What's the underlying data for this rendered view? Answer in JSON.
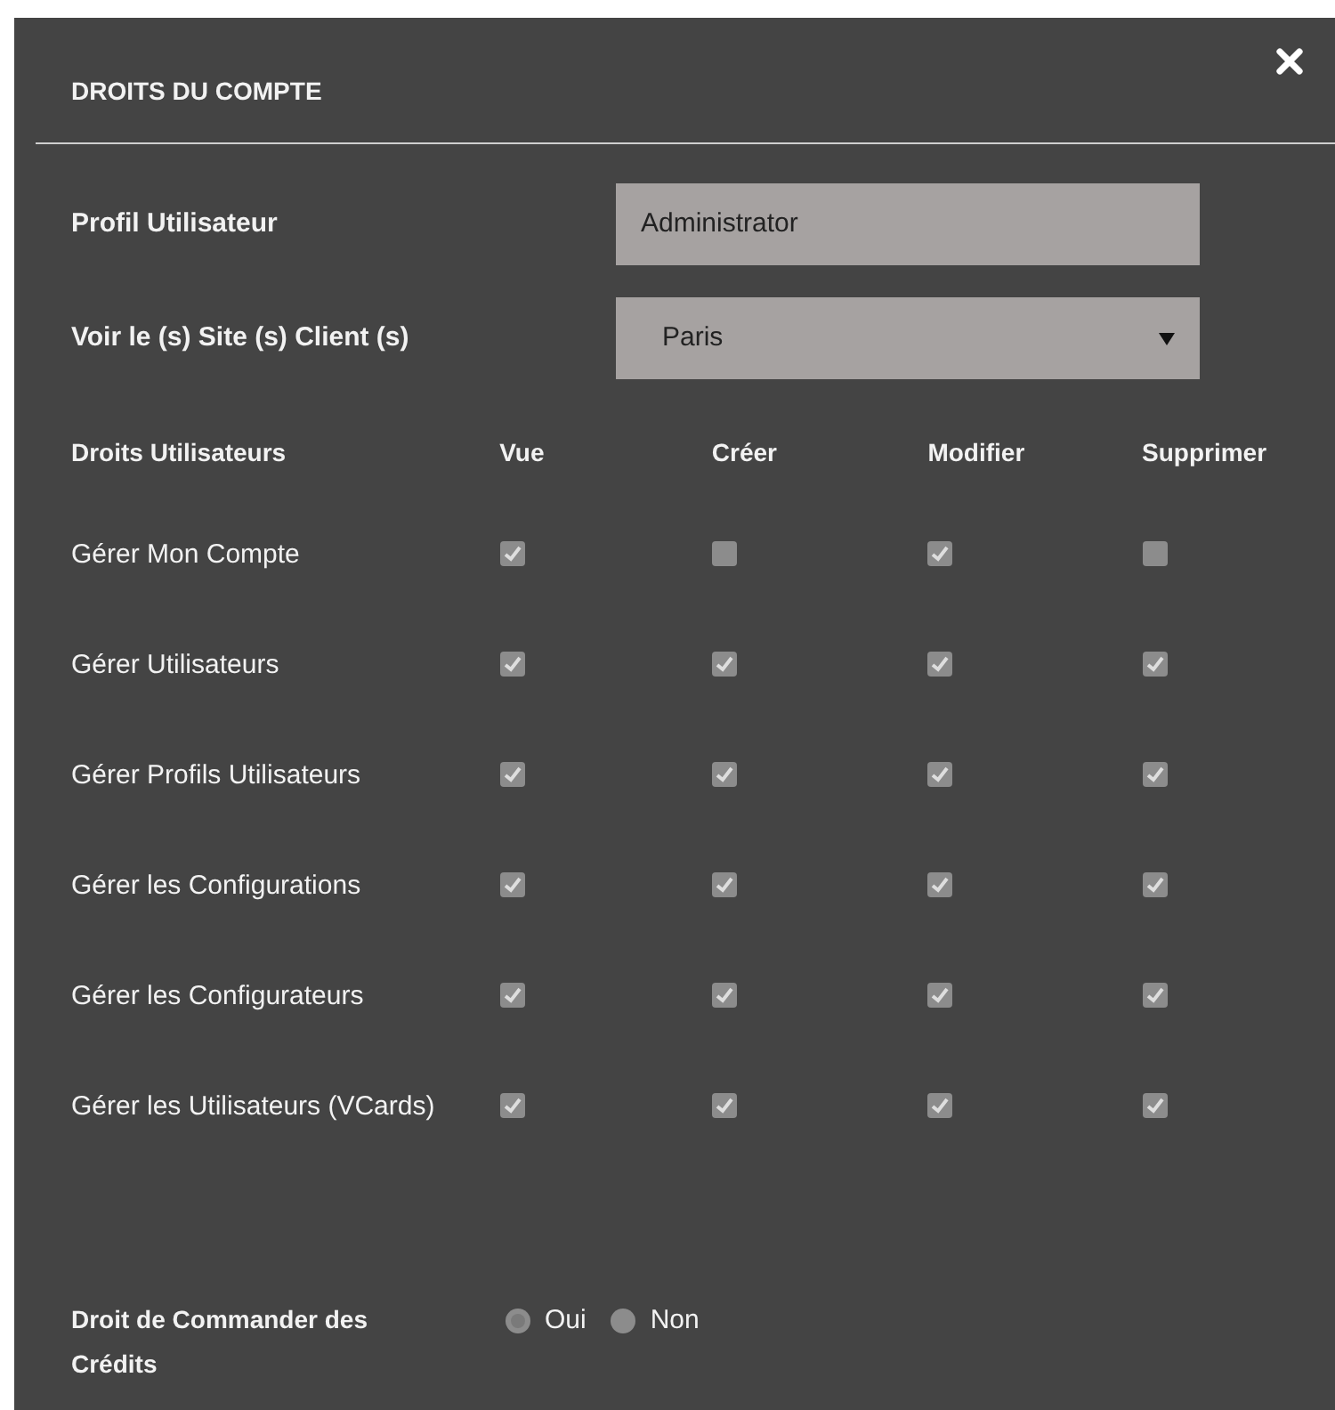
{
  "modal": {
    "title": "DROITS DU COMPTE",
    "fields": [
      {
        "label": "Profil Utilisateur",
        "kind": "text",
        "value": "Administrator"
      },
      {
        "label": "Voir le (s) Site (s) Client (s)",
        "kind": "select",
        "value": "Paris"
      }
    ],
    "rights": {
      "columns": [
        "Droits Utilisateurs",
        "Vue",
        "Créer",
        "Modifier",
        "Supprimer"
      ],
      "rows": [
        {
          "label": "Gérer Mon Compte",
          "cells": [
            {
              "checked": true
            },
            {
              "checked": false
            },
            {
              "checked": true
            },
            {
              "checked": false
            }
          ]
        },
        {
          "label": "Gérer Utilisateurs",
          "cells": [
            {
              "checked": true
            },
            {
              "checked": true
            },
            {
              "checked": true
            },
            {
              "checked": true
            }
          ]
        },
        {
          "label": "Gérer Profils Utilisateurs",
          "cells": [
            {
              "checked": true
            },
            {
              "checked": true
            },
            {
              "checked": true
            },
            {
              "checked": true
            }
          ]
        },
        {
          "label": "Gérer les Configurations",
          "cells": [
            {
              "checked": true
            },
            {
              "checked": true
            },
            {
              "checked": true
            },
            {
              "checked": true
            }
          ]
        },
        {
          "label": "Gérer les Configurateurs",
          "cells": [
            {
              "checked": true
            },
            {
              "checked": true
            },
            {
              "checked": true
            },
            {
              "checked": true
            }
          ]
        },
        {
          "label": "Gérer les Utilisateurs (VCards)",
          "cells": [
            {
              "checked": true
            },
            {
              "checked": true
            },
            {
              "checked": true
            },
            {
              "checked": true
            }
          ]
        }
      ]
    },
    "order_credits": {
      "label": "Droit de Commander des Crédits",
      "options": [
        {
          "label": "Oui",
          "selected": true
        },
        {
          "label": "Non",
          "selected": false
        }
      ]
    }
  }
}
